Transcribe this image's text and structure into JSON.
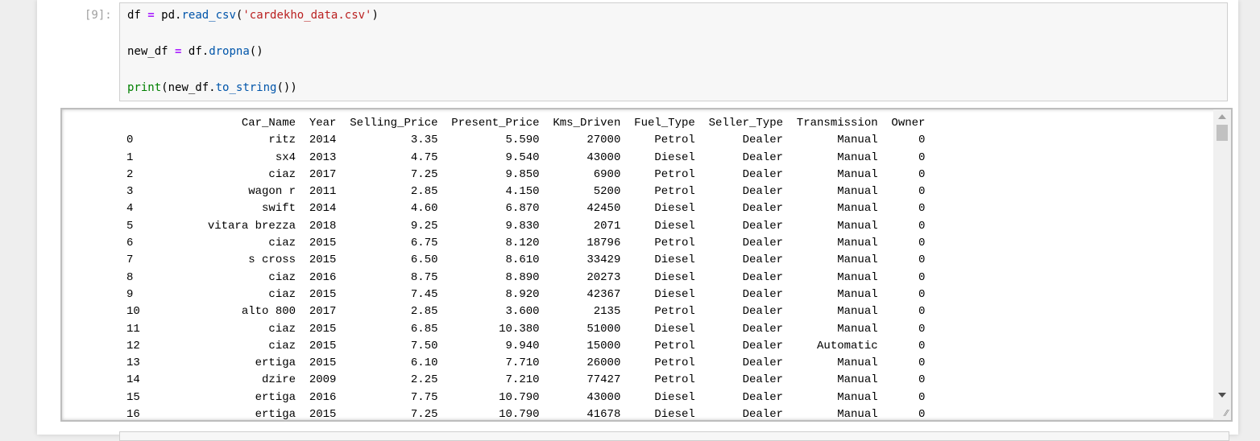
{
  "cell": {
    "prompt": "[9]:",
    "code": {
      "line1": {
        "a": "df",
        "op": "=",
        "b": "pd",
        "dot": ".",
        "fn": "read_csv",
        "open": "(",
        "str": "'cardekho_data.csv'",
        "close": ")"
      },
      "line2": {
        "a": "new_df",
        "op": "=",
        "b": "df",
        "dot": ".",
        "fn": "dropna",
        "paren": "()"
      },
      "line3": {
        "fn": "print",
        "open": "(",
        "b": "new_df",
        "dot": ".",
        "attr": "to_string",
        "close": "())"
      }
    }
  },
  "output": {
    "columns": [
      "",
      "Car_Name",
      "Year",
      "Selling_Price",
      "Present_Price",
      "Kms_Driven",
      "Fuel_Type",
      "Seller_Type",
      "Transmission",
      "Owner"
    ],
    "rows": [
      [
        "0",
        "ritz",
        "2014",
        "3.35",
        "5.590",
        "27000",
        "Petrol",
        "Dealer",
        "Manual",
        "0"
      ],
      [
        "1",
        "sx4",
        "2013",
        "4.75",
        "9.540",
        "43000",
        "Diesel",
        "Dealer",
        "Manual",
        "0"
      ],
      [
        "2",
        "ciaz",
        "2017",
        "7.25",
        "9.850",
        "6900",
        "Petrol",
        "Dealer",
        "Manual",
        "0"
      ],
      [
        "3",
        "wagon r",
        "2011",
        "2.85",
        "4.150",
        "5200",
        "Petrol",
        "Dealer",
        "Manual",
        "0"
      ],
      [
        "4",
        "swift",
        "2014",
        "4.60",
        "6.870",
        "42450",
        "Diesel",
        "Dealer",
        "Manual",
        "0"
      ],
      [
        "5",
        "vitara brezza",
        "2018",
        "9.25",
        "9.830",
        "2071",
        "Diesel",
        "Dealer",
        "Manual",
        "0"
      ],
      [
        "6",
        "ciaz",
        "2015",
        "6.75",
        "8.120",
        "18796",
        "Petrol",
        "Dealer",
        "Manual",
        "0"
      ],
      [
        "7",
        "s cross",
        "2015",
        "6.50",
        "8.610",
        "33429",
        "Diesel",
        "Dealer",
        "Manual",
        "0"
      ],
      [
        "8",
        "ciaz",
        "2016",
        "8.75",
        "8.890",
        "20273",
        "Diesel",
        "Dealer",
        "Manual",
        "0"
      ],
      [
        "9",
        "ciaz",
        "2015",
        "7.45",
        "8.920",
        "42367",
        "Diesel",
        "Dealer",
        "Manual",
        "0"
      ],
      [
        "10",
        "alto 800",
        "2017",
        "2.85",
        "3.600",
        "2135",
        "Petrol",
        "Dealer",
        "Manual",
        "0"
      ],
      [
        "11",
        "ciaz",
        "2015",
        "6.85",
        "10.380",
        "51000",
        "Diesel",
        "Dealer",
        "Manual",
        "0"
      ],
      [
        "12",
        "ciaz",
        "2015",
        "7.50",
        "9.940",
        "15000",
        "Petrol",
        "Dealer",
        "Automatic",
        "0"
      ],
      [
        "13",
        "ertiga",
        "2015",
        "6.10",
        "7.710",
        "26000",
        "Petrol",
        "Dealer",
        "Manual",
        "0"
      ],
      [
        "14",
        "dzire",
        "2009",
        "2.25",
        "7.210",
        "77427",
        "Petrol",
        "Dealer",
        "Manual",
        "0"
      ],
      [
        "15",
        "ertiga",
        "2016",
        "7.75",
        "10.790",
        "43000",
        "Diesel",
        "Dealer",
        "Manual",
        "0"
      ],
      [
        "16",
        "ertiga",
        "2015",
        "7.25",
        "10.790",
        "41678",
        "Diesel",
        "Dealer",
        "Manual",
        "0"
      ]
    ]
  },
  "icons": {
    "scroll_up": "chevron-up-icon",
    "scroll_down": "chevron-down-icon",
    "resize": "resize-handle-icon"
  },
  "colors": {
    "operator": "#aa22ff",
    "attribute": "#0055aa",
    "string": "#ba2121",
    "builtin": "#008000"
  }
}
